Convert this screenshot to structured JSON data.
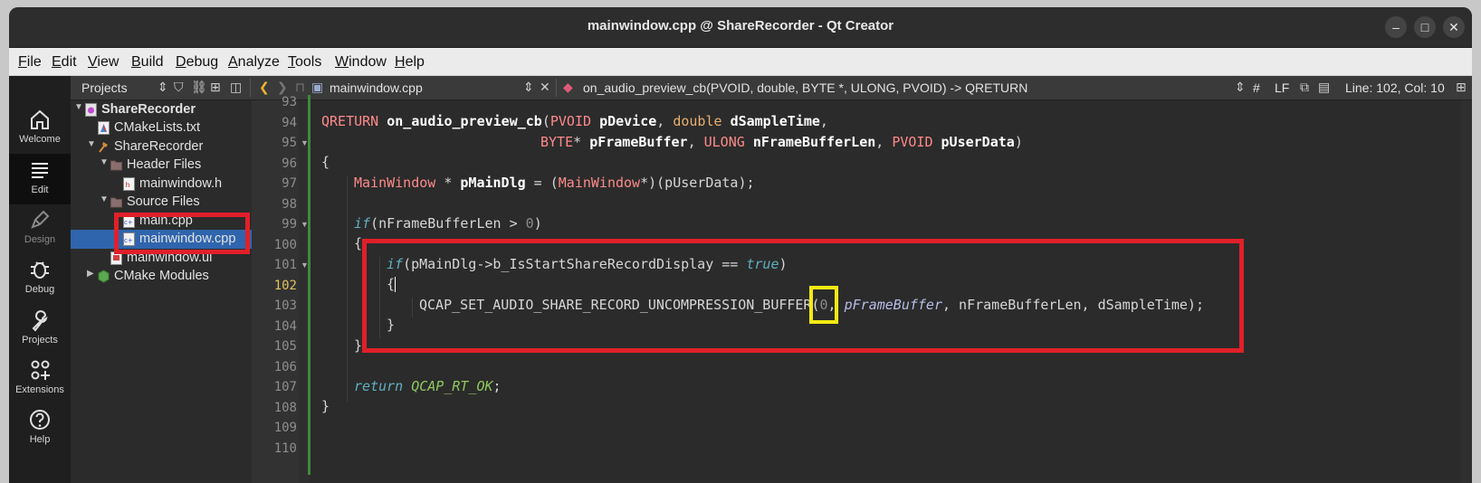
{
  "window": {
    "title": "mainwindow.cpp @ ShareRecorder - Qt Creator",
    "controls": {
      "minimize": "–",
      "maximize": "□",
      "close": "✕"
    }
  },
  "menubar": [
    "File",
    "Edit",
    "View",
    "Build",
    "Debug",
    "Analyze",
    "Tools",
    "Window",
    "Help"
  ],
  "modes": [
    {
      "label": "Welcome",
      "icon": "home-icon"
    },
    {
      "label": "Edit",
      "icon": "edit-lines-icon"
    },
    {
      "label": "Design",
      "icon": "pen-icon"
    },
    {
      "label": "Debug",
      "icon": "bug-icon"
    },
    {
      "label": "Projects",
      "icon": "wrench-icon"
    },
    {
      "label": "Extensions",
      "icon": "extensions-icon"
    },
    {
      "label": "Help",
      "icon": "help-icon"
    }
  ],
  "toolbar": {
    "projects_label": "Projects",
    "file_label": "mainwindow.cpp",
    "function_label": "on_audio_preview_cb(PVOID, double, BYTE *, ULONG, PVOID) -> QRETURN",
    "hash": "#",
    "line_ending": "LF",
    "position": "Line: 102, Col: 10"
  },
  "tree": [
    {
      "label": "ShareRecorder",
      "level": 0,
      "arrow": "▼",
      "icon": "project-icon",
      "bold": true
    },
    {
      "label": "CMakeLists.txt",
      "level": 1,
      "arrow": "",
      "icon": "cmake-file-icon"
    },
    {
      "label": "ShareRecorder",
      "level": 1,
      "arrow": "▼",
      "icon": "hammer-icon"
    },
    {
      "label": "Header Files",
      "level": 2,
      "arrow": "▼",
      "icon": "folder-icon"
    },
    {
      "label": "mainwindow.h",
      "level": 3,
      "arrow": "",
      "icon": "header-file-icon"
    },
    {
      "label": "Source Files",
      "level": 2,
      "arrow": "▼",
      "icon": "folder-icon"
    },
    {
      "label": "main.cpp",
      "level": 3,
      "arrow": "",
      "icon": "cpp-file-icon"
    },
    {
      "label": "mainwindow.cpp",
      "level": 3,
      "arrow": "",
      "icon": "cpp-file-icon",
      "selected": true
    },
    {
      "label": "mainwindow.ui",
      "level": 3,
      "arrow": "",
      "icon": "ui-file-icon"
    },
    {
      "label": "CMake Modules",
      "level": 1,
      "arrow": "▶",
      "icon": "cmake-modules-icon"
    }
  ],
  "line_numbers": [
    "93",
    "94",
    "95",
    "96",
    "97",
    "98",
    "99",
    "100",
    "101",
    "102",
    "103",
    "104",
    "105",
    "106",
    "107",
    "108",
    "109",
    "110"
  ],
  "current_line": "102",
  "code": {
    "l94": {
      "t1": "QRETURN",
      "t2": " ",
      "t3": "on_audio_preview_cb",
      "t4": "(",
      "t5": "PVOID",
      "t6": " ",
      "t7": "pDevice",
      "t8": ", ",
      "t9": "double",
      "t10": " ",
      "t11": "dSampleTime",
      "t12": ","
    },
    "l95": {
      "t1": "BYTE",
      "t2": "* ",
      "t3": "pFrameBuffer",
      "t4": ", ",
      "t5": "ULONG",
      "t6": " ",
      "t7": "nFrameBufferLen",
      "t8": ", ",
      "t9": "PVOID",
      "t10": " ",
      "t11": "pUserData",
      "t12": ")"
    },
    "l96": "{",
    "l97": {
      "t1": "MainWindow",
      "t2": " * ",
      "t3": "pMainDlg",
      "t4": " = (",
      "t5": "MainWindow",
      "t6": "*)(pUserData);"
    },
    "l99": {
      "t1": "if",
      "t2": "(nFrameBufferLen > ",
      "t3": "0",
      "t4": ")"
    },
    "l100": "{",
    "l101": {
      "t1": "if",
      "t2": "(pMainDlg->b_IsStartShareRecordDisplay == ",
      "t3": "true",
      "t4": ")"
    },
    "l102": "{",
    "l103": {
      "t1": "QCAP_SET_AUDIO_SHARE_RECORD_UNCOMPRESSION_BUFFER(",
      "t2": "0",
      "t3": ", ",
      "t4": "pFrameBuffer",
      "t5": ", nFrameBufferLen, dSampleTime);"
    },
    "l104": "}",
    "l105": "}",
    "l107": {
      "t1": "return",
      "t2": " ",
      "t3": "QCAP_RT_OK",
      "t4": ";"
    },
    "l108": "}"
  },
  "annotation_colors": {
    "red_box": "#e0202a",
    "yellow_box": "#f2ea12",
    "selection": "#2f65ad"
  }
}
